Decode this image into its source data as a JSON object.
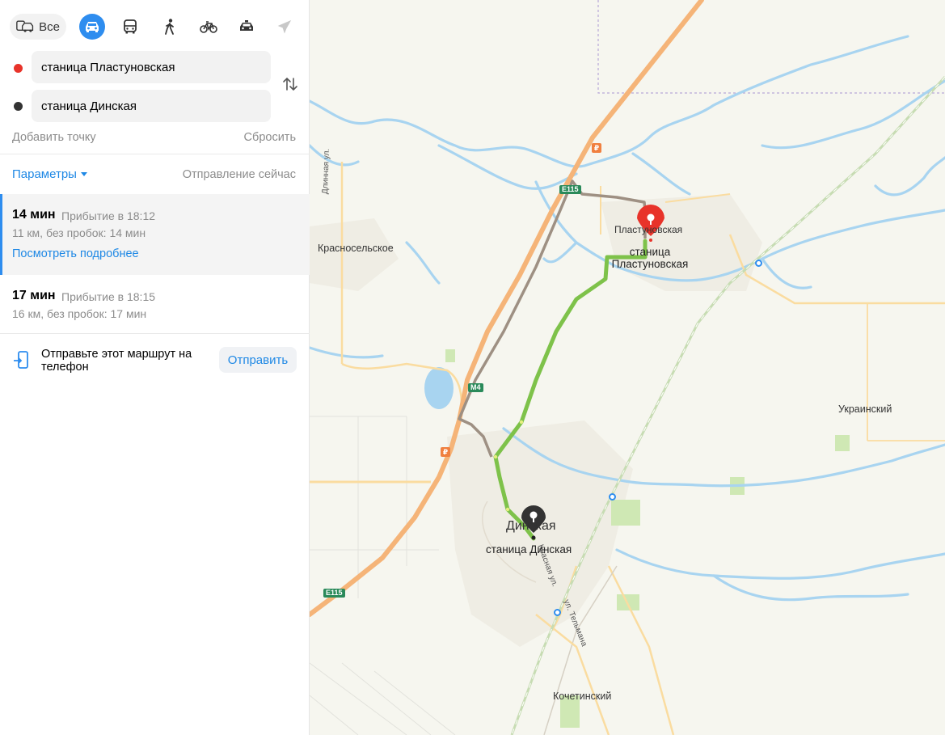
{
  "transport_modes": [
    {
      "id": "all",
      "label": "Все",
      "icon": "car-bus-icon",
      "active": false
    },
    {
      "id": "car",
      "icon": "car-icon",
      "active": true
    },
    {
      "id": "transit",
      "icon": "bus-icon",
      "active": false
    },
    {
      "id": "walk",
      "icon": "pedestrian-icon",
      "active": false
    },
    {
      "id": "bike",
      "icon": "bicycle-icon",
      "active": false
    },
    {
      "id": "taxi",
      "icon": "taxi-icon",
      "active": false
    },
    {
      "id": "plane",
      "icon": "plane-icon",
      "active": false
    }
  ],
  "route_form": {
    "from": "станица Пластуновская",
    "to": "станица Динская",
    "add_point": "Добавить точку",
    "reset": "Сбросить",
    "from_color": "#e8332a",
    "to_color": "#333333"
  },
  "options": {
    "params": "Параметры",
    "departure": "Отправление сейчас"
  },
  "routes": [
    {
      "time": "14 мин",
      "arrival": "Прибытие в 18:12",
      "details": "11 км, без пробок: 14 мин",
      "more": "Посмотреть подробнее",
      "selected": true
    },
    {
      "time": "17 мин",
      "arrival": "Прибытие в 18:15",
      "details": "16 км, без пробок: 17 мин",
      "selected": false
    }
  ],
  "send": {
    "text": "Отправьте этот маршрут на телефон",
    "button": "Отправить"
  },
  "map": {
    "labels": {
      "krasnoselskoe": "Красносельское",
      "plast_small": "Пластуновская",
      "plast_station": "станица\nПластуновская",
      "dinskaya": "Динская",
      "dinskaya_station": "станица Динская",
      "ukrainsky": "Украинский",
      "kochetinsky": "Кочетинский",
      "dlinnaya": "Длинная ул.",
      "telmana": "ул. Тельмана",
      "krasnaya": "Красная ул.",
      "e115_top": "E115",
      "e115_bottom": "E115",
      "m4": "M4",
      "toll_top": "₽",
      "toll_bottom": "₽"
    },
    "colors": {
      "background": "#f6f6ef",
      "water": "#a8d4f0",
      "highway": "#f5b478",
      "main_route": "#7ec24a",
      "alt_route": "#9e9083",
      "start_marker": "#e8332a",
      "end_marker": "#333333"
    }
  }
}
